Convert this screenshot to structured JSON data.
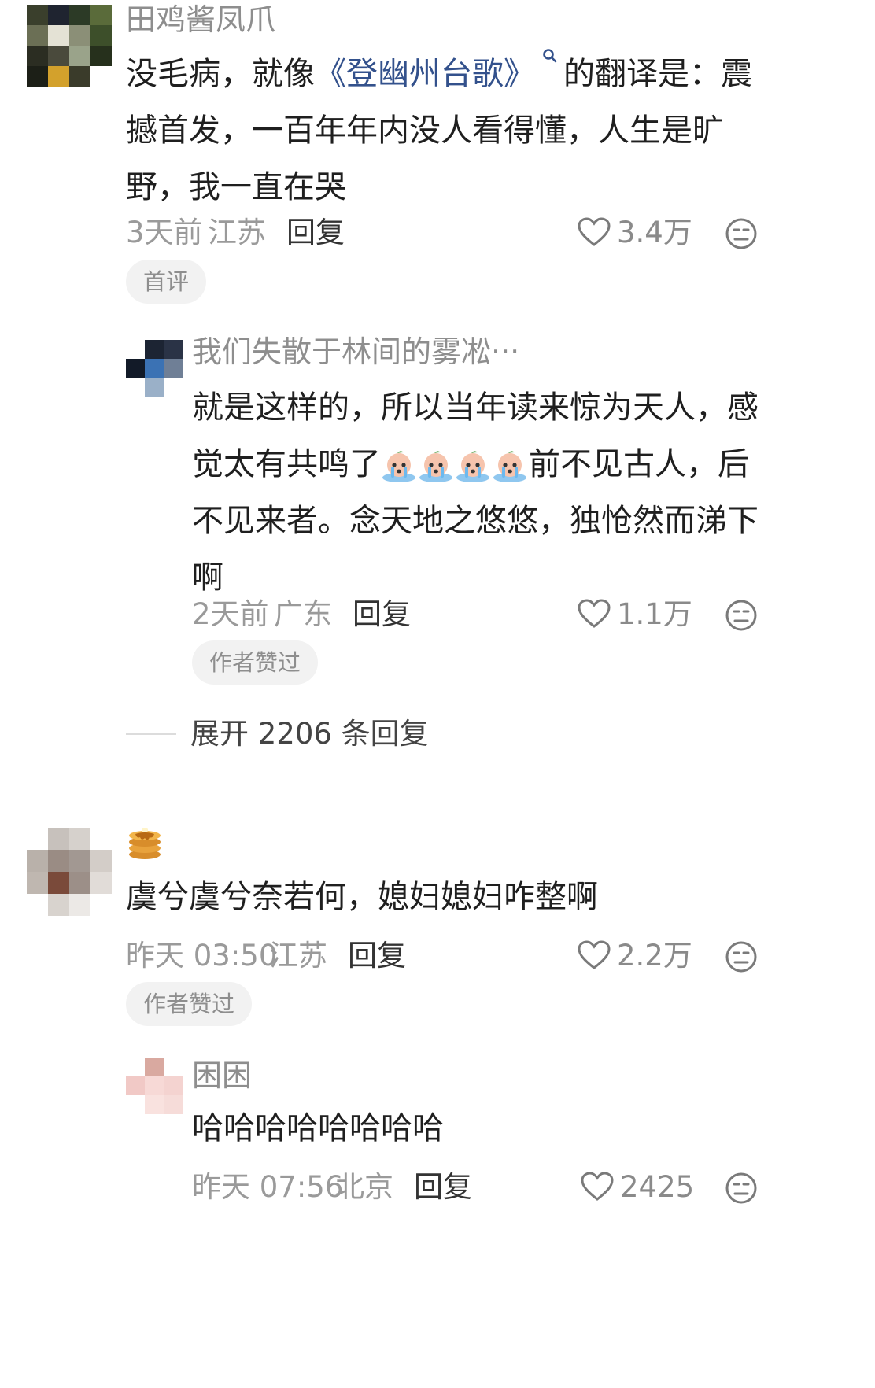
{
  "comments": [
    {
      "username": "田鸡酱凤爪",
      "text_before_link": "没毛病，就像",
      "link_text": "《登幽州台歌》",
      "text_after_link": "的翻译是：震撼首发，一百年年内没人看得懂，人生是旷野，我一直在哭",
      "time": "3天前",
      "location": "江苏",
      "reply_label": "回复",
      "likes": "3.4万",
      "badge": "首评",
      "replies": [
        {
          "username": "我们失散于林间的雾凇···",
          "text_before_emoji": "就是这样的，所以当年读来惊为天人，感觉太有共鸣了",
          "text_after_emoji": "前不见古人，后不见来者。念天地之悠悠，独怆然而涕下啊",
          "time": "2天前",
          "location": "广东",
          "reply_label": "回复",
          "likes": "1.1万",
          "badge": "作者赞过"
        }
      ],
      "expand_label": "展开 2206 条回复"
    },
    {
      "username_icon": "pancake-icon",
      "text": "虞兮虞兮奈若何，媳妇媳妇咋整啊",
      "time": "昨天 03:50",
      "location": "江苏",
      "reply_label": "回复",
      "likes": "2.2万",
      "badge": "作者赞过",
      "replies": [
        {
          "username": "困困",
          "text": "哈哈哈哈哈哈哈哈",
          "time": "昨天 07:56",
          "location": "北京",
          "reply_label": "回复",
          "likes": "2425"
        }
      ]
    }
  ],
  "colors": {
    "link": "#33518c",
    "meta_gray": "#9a9a9a",
    "badge_bg": "#f2f2f2"
  }
}
